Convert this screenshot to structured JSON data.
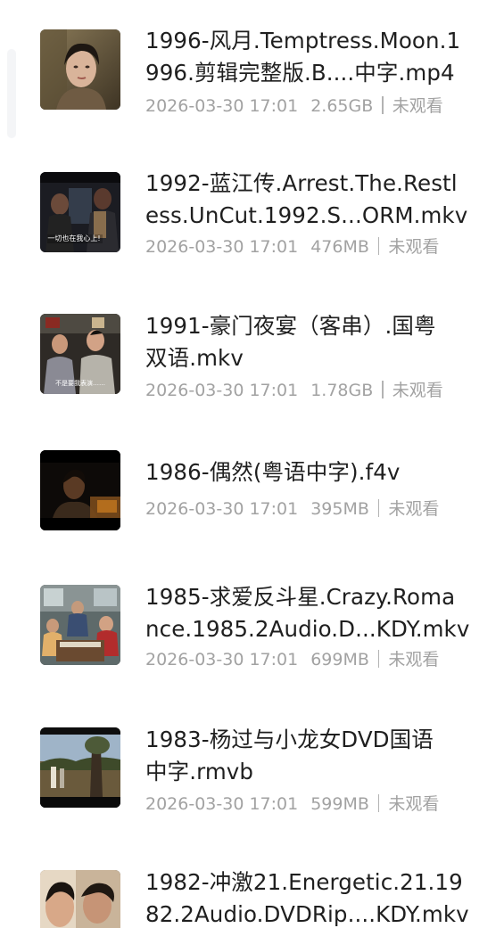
{
  "files": [
    {
      "name_lines": [
        "1996-风月.Temptress.Moon.1",
        "996.剪辑完整版.B....中字.mp4"
      ],
      "date": "2026-03-30 17:01",
      "size": "2.65GB",
      "status": "未观看",
      "thumb_icon": "video-thumbnail-icon"
    },
    {
      "name_lines": [
        "1992-蓝江传.Arrest.The.Restl",
        "ess.UnCut.1992.S...ORM.mkv"
      ],
      "date": "2026-03-30 17:01",
      "size": "476MB",
      "status": "未观看",
      "thumb_icon": "video-thumbnail-icon",
      "thumb_caption": "一切也在我心上!"
    },
    {
      "name_lines": [
        "1991-豪门夜宴（客串）.国粤",
        "双语.mkv"
      ],
      "date": "2026-03-30 17:01",
      "size": "1.78GB",
      "status": "未观看",
      "thumb_icon": "video-thumbnail-icon",
      "thumb_caption": "不是要我表演……"
    },
    {
      "name_lines": [
        "1986-偶然(粤语中字).f4v"
      ],
      "date": "2026-03-30 17:01",
      "size": "395MB",
      "status": "未观看",
      "thumb_icon": "video-thumbnail-icon"
    },
    {
      "name_lines": [
        "1985-求爱反斗星.Crazy.Roma",
        "nce.1985.2Audio.D...KDY.mkv"
      ],
      "date": "2026-03-30 17:01",
      "size": "699MB",
      "status": "未观看",
      "thumb_icon": "video-thumbnail-icon"
    },
    {
      "name_lines": [
        "1983-杨过与小龙女DVD国语",
        "中字.rmvb"
      ],
      "date": "2026-03-30 17:01",
      "size": "599MB",
      "status": "未观看",
      "thumb_icon": "video-thumbnail-icon"
    },
    {
      "name_lines": [
        "1982-冲激21.Energetic.21.19",
        "82.2Audio.DVDRip....KDY.mkv"
      ],
      "date": "",
      "size": "",
      "status": "",
      "thumb_icon": "video-thumbnail-icon"
    }
  ],
  "colors": {
    "name_text": "#1f1f1f",
    "meta_text": "#a2a2a2",
    "background": "#ffffff"
  }
}
